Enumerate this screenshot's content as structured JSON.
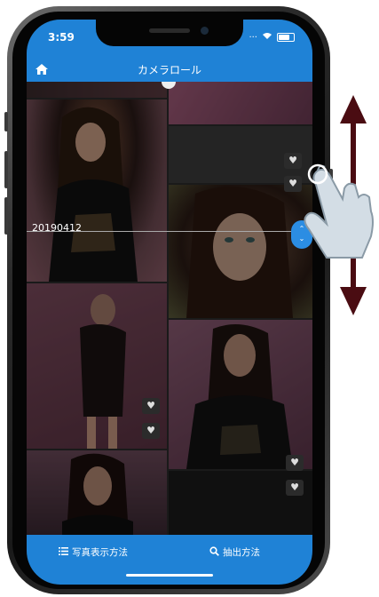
{
  "status_bar": {
    "time": "3:59"
  },
  "nav": {
    "title": "カメラロール"
  },
  "grid": {
    "date_label": "20190412"
  },
  "toolbar": {
    "photo_display_label": "写真表示方法",
    "filter_label": "抽出方法"
  },
  "colors": {
    "accent": "#1f82d6",
    "arrow": "#4a0c12",
    "scroll_handle": "#2b8de3"
  },
  "icons": {
    "home": "home-icon",
    "list": "list-icon",
    "search": "search-icon",
    "heart": "heart-icon",
    "scroll": "chevron-up-down-icon",
    "hand": "hand-pointer-icon"
  }
}
